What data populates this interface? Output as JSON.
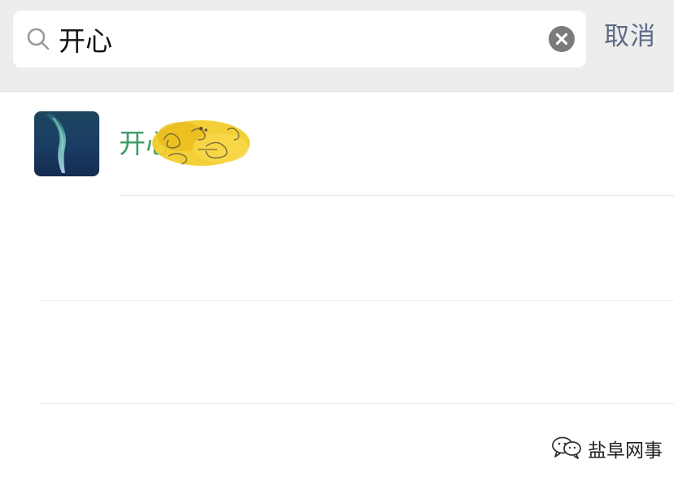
{
  "search": {
    "query": "开心",
    "cancel_label": "取消"
  },
  "results": [
    {
      "name_visible": "开心"
    }
  ],
  "watermark": {
    "text": "盐阜网事"
  },
  "colors": {
    "search_bar_bg": "#ededed",
    "match_text": "#3d9c68",
    "cancel_text": "#5e6a86",
    "clear_icon_bg": "#7b7b7b"
  },
  "icons": {
    "search": "search-icon",
    "clear": "clear-icon",
    "watermark": "wechat-official-account-icon"
  }
}
